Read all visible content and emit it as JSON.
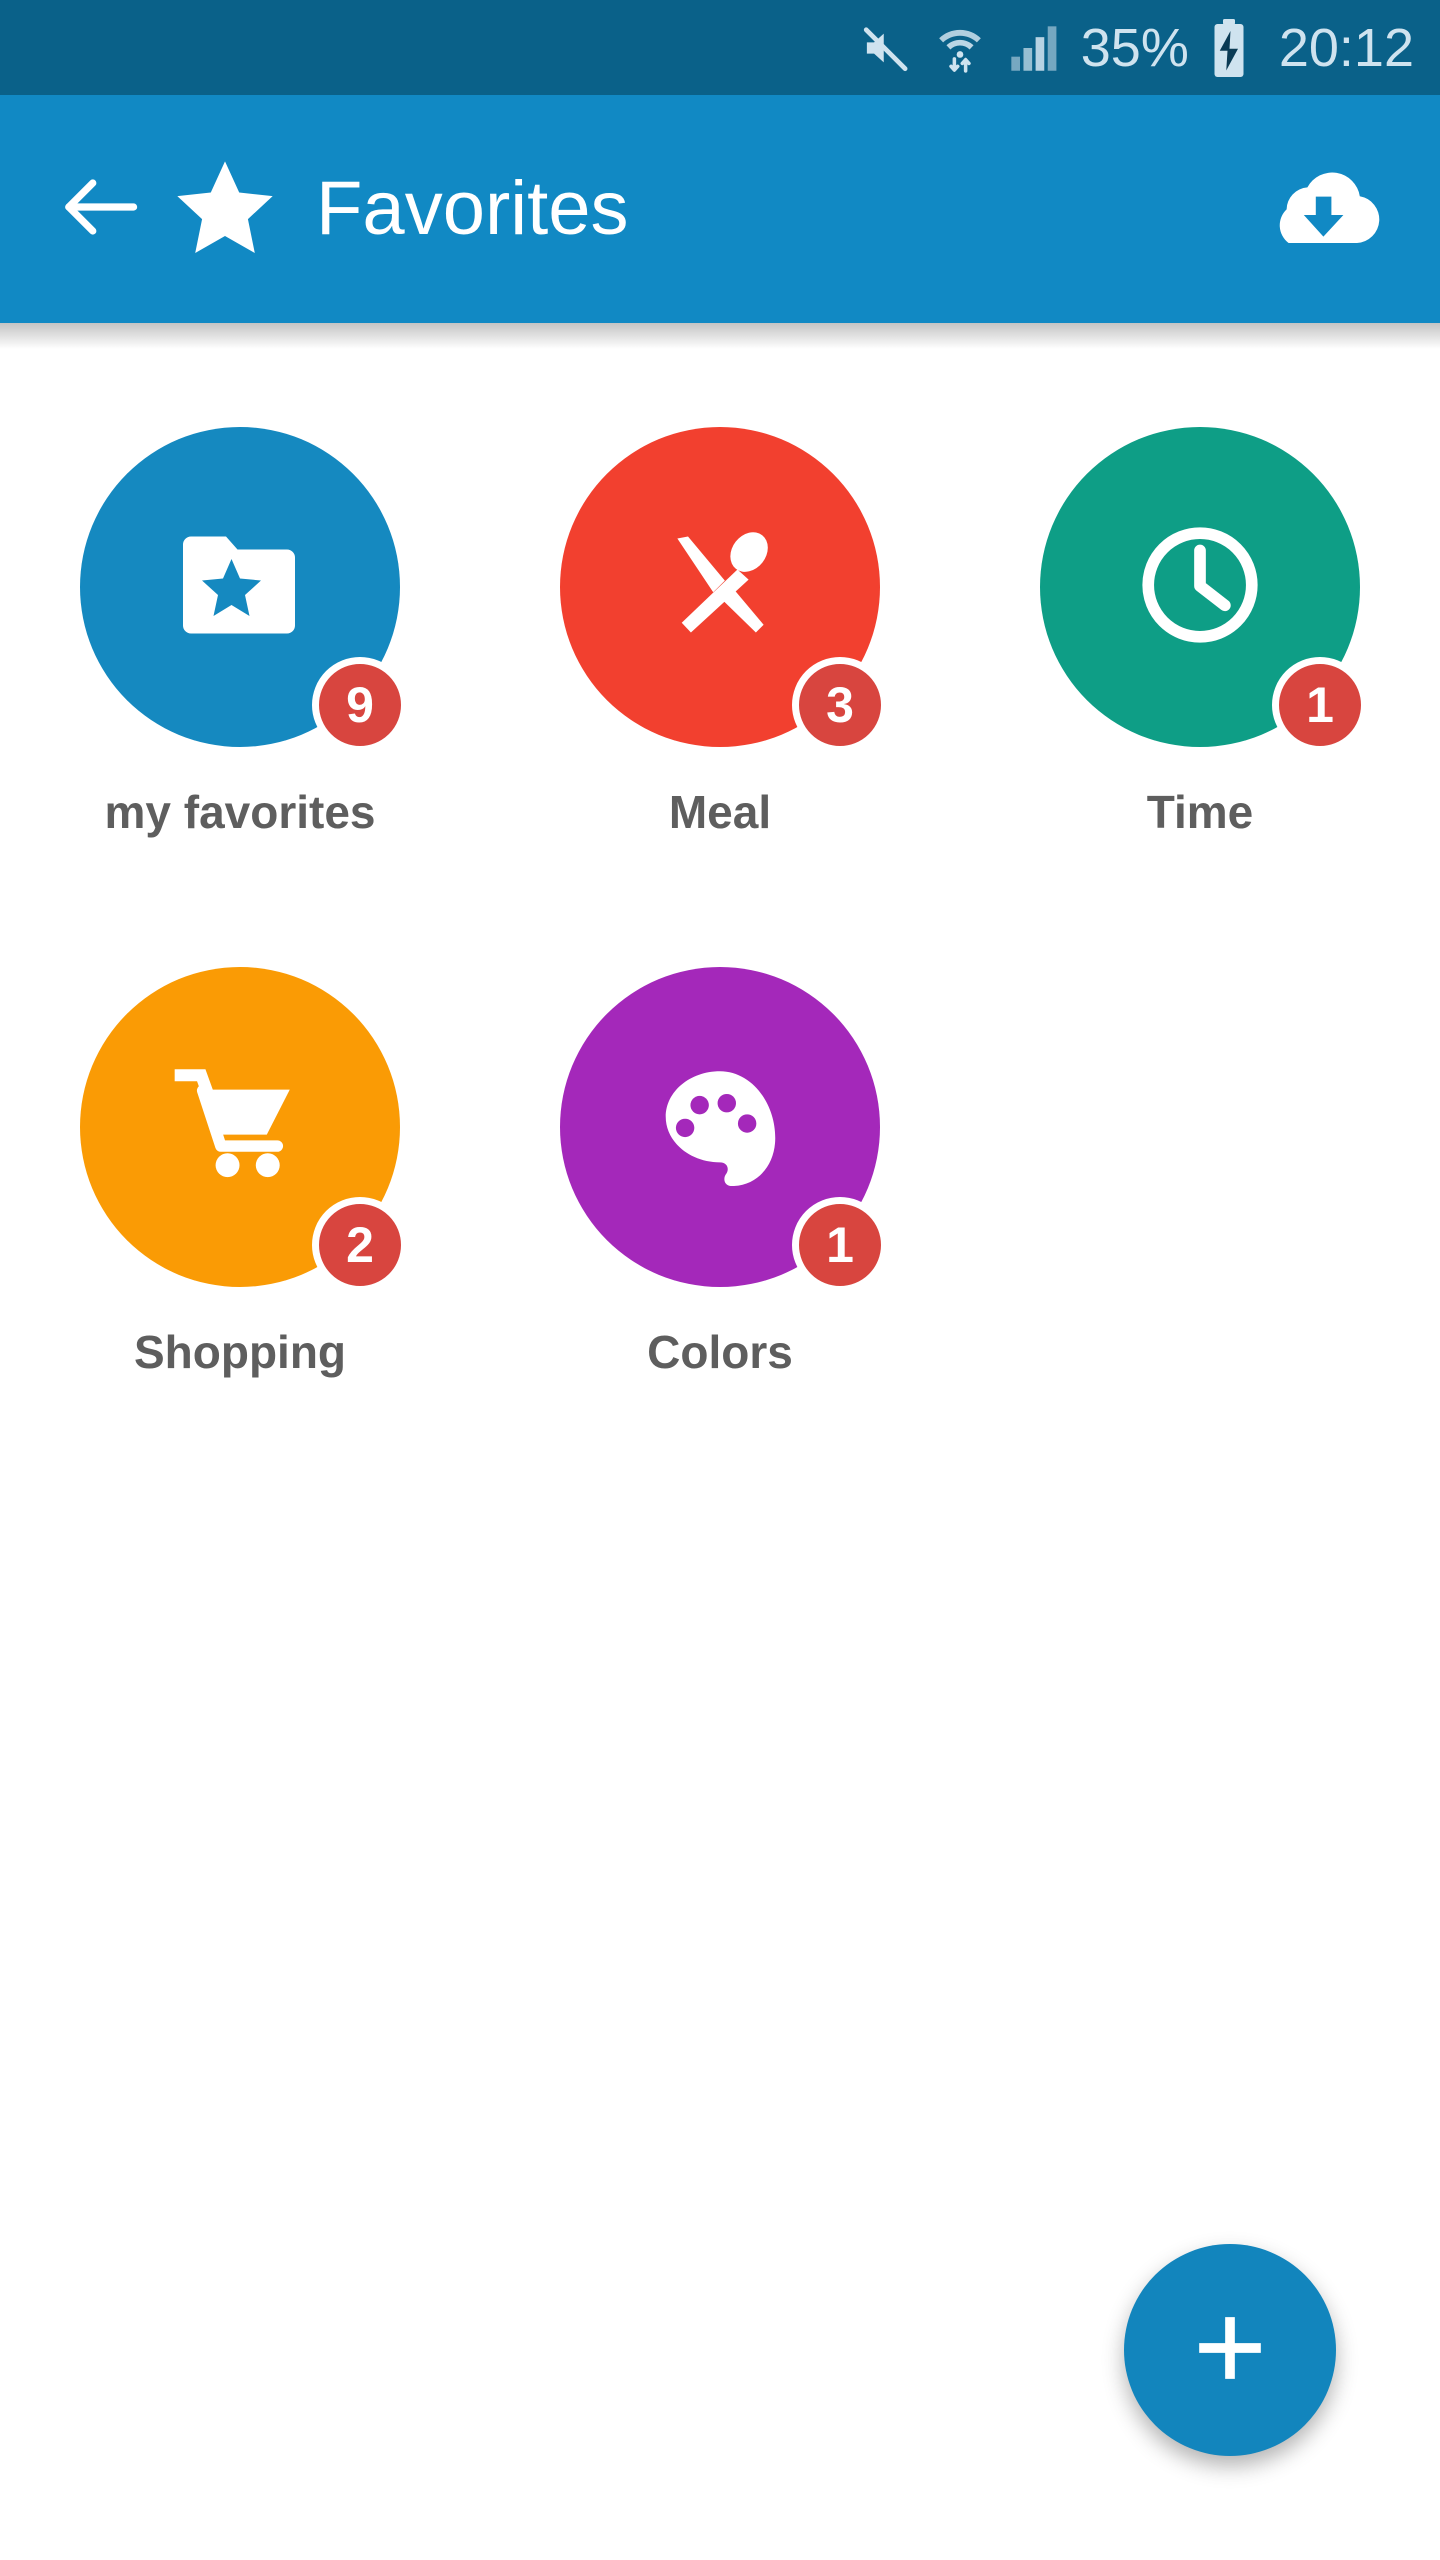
{
  "status_bar": {
    "background": "#0a6189",
    "icons": [
      "mute-icon",
      "wifi-transfer-icon",
      "signal-bars-icon"
    ],
    "battery_percent": "35%",
    "battery_state": "charging",
    "clock": "20:12"
  },
  "app_bar": {
    "background": "#1189c4",
    "back_icon": "arrow-left-icon",
    "brand_icon": "star-icon",
    "title": "Favorites",
    "action_icon": "cloud-download-icon"
  },
  "grid": {
    "items": [
      {
        "label": "my favorites",
        "icon": "folder-star-icon",
        "color": "#1589c0",
        "badge": "9"
      },
      {
        "label": "Meal",
        "icon": "cutlery-icon",
        "color": "#f2402f",
        "badge": "3"
      },
      {
        "label": "Time",
        "icon": "clock-icon",
        "color": "#0e9e86",
        "badge": "1"
      },
      {
        "label": "Shopping",
        "icon": "shopping-cart-icon",
        "color": "#fa9b05",
        "badge": "2"
      },
      {
        "label": "Colors",
        "icon": "palette-icon",
        "color": "#a428ba",
        "badge": "1"
      }
    ],
    "badge_color": "#d8453f",
    "label_color": "#5e5e5e"
  },
  "fab": {
    "icon": "plus-icon",
    "color": "#1285bd"
  }
}
